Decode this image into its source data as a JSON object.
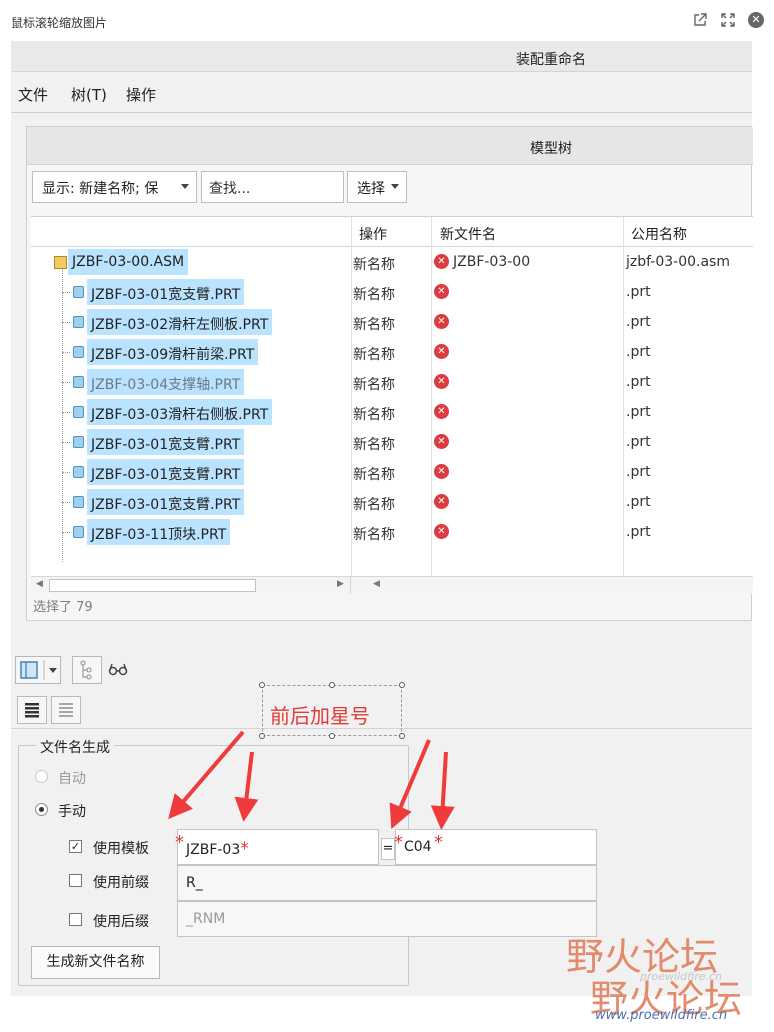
{
  "viewer": {
    "title": "鼠标滚轮缩放图片",
    "icons": [
      "external-link-icon",
      "fullscreen-icon",
      "close-icon"
    ]
  },
  "dialog": {
    "title": "装配重命名",
    "menu": [
      "文件",
      "树(T)",
      "操作"
    ]
  },
  "model_tree": {
    "title": "模型树",
    "display_dropdown": "显示: 新建名称; 保",
    "search_placeholder": "查找...",
    "select_dropdown": "选择",
    "columns": [
      "操作",
      "新文件名",
      "公用名称"
    ],
    "rows": [
      {
        "name": "JZBF-03-00.ASM",
        "op": "新名称",
        "new_name": "JZBF-03-00",
        "common": "jzbf-03-00.asm",
        "type": "asm",
        "dim": false
      },
      {
        "name": "JZBF-03-01宽支臂.PRT",
        "op": "新名称",
        "new_name": "",
        "common": ".prt",
        "type": "prt",
        "dim": false
      },
      {
        "name": "JZBF-03-02滑杆左侧板.PRT",
        "op": "新名称",
        "new_name": "",
        "common": ".prt",
        "type": "prt",
        "dim": false
      },
      {
        "name": "JZBF-03-09滑杆前梁.PRT",
        "op": "新名称",
        "new_name": "",
        "common": ".prt",
        "type": "prt",
        "dim": false
      },
      {
        "name": "JZBF-03-04支撑轴.PRT",
        "op": "新名称",
        "new_name": "",
        "common": ".prt",
        "type": "prt",
        "dim": true
      },
      {
        "name": "JZBF-03-03滑杆右侧板.PRT",
        "op": "新名称",
        "new_name": "",
        "common": ".prt",
        "type": "prt",
        "dim": false
      },
      {
        "name": "JZBF-03-01宽支臂.PRT",
        "op": "新名称",
        "new_name": "",
        "common": ".prt",
        "type": "prt",
        "dim": false
      },
      {
        "name": "JZBF-03-01宽支臂.PRT",
        "op": "新名称",
        "new_name": "",
        "common": ".prt",
        "type": "prt",
        "dim": false
      },
      {
        "name": "JZBF-03-01宽支臂.PRT",
        "op": "新名称",
        "new_name": "",
        "common": ".prt",
        "type": "prt",
        "dim": false
      },
      {
        "name": "JZBF-03-11顶块.PRT",
        "op": "新名称",
        "new_name": "",
        "common": ".prt",
        "type": "prt",
        "dim": false
      }
    ],
    "selected_text": "选择了 79"
  },
  "annotation": {
    "text": "前后加星号",
    "color": "#e23a3a"
  },
  "filename_gen": {
    "title": "文件名生成",
    "auto_label": "自动",
    "manual_label": "手动",
    "use_template_label": "使用模板",
    "template_value": "JZBF-03",
    "equals": "=",
    "template_new_value": "C04",
    "use_prefix_label": "使用前缀",
    "prefix_value": "R_",
    "use_suffix_label": "使用后缀",
    "suffix_placeholder": "_RNM",
    "generate_button": "生成新文件名称",
    "star": "*"
  },
  "watermark": {
    "text": "野火论坛",
    "url": "www.proewildfire.cn",
    "url_faint": "proewildfire.cn"
  }
}
